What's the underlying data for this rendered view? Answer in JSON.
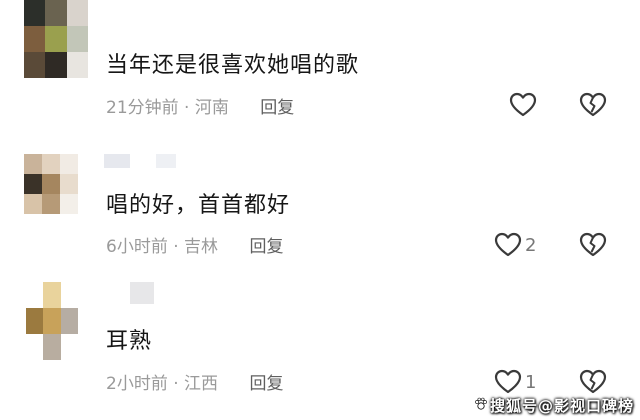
{
  "comments": [
    {
      "text": "当年还是很喜欢她唱的歌",
      "time": "21分钟前",
      "separator": "·",
      "location": "河南",
      "reply_label": "回复",
      "like_count": "",
      "avatar_colors": [
        "#2c2f2a",
        "#6a6350",
        "#d9d3cc",
        "#7d5e3e",
        "#9aa04e",
        "#c2c6b8",
        "#5a4a38",
        "#2f2a25",
        "#e8e5e0"
      ]
    },
    {
      "text": "唱的好，首首都好",
      "time": "6小时前",
      "separator": "·",
      "location": "吉林",
      "reply_label": "回复",
      "like_count": "2",
      "avatar_colors": [
        "#c9b39a",
        "#e2d2bf",
        "#f1ebe4",
        "#3a3228",
        "#a5865f",
        "#e8dccd",
        "#d8c3a8",
        "#b69a77",
        "#f3efe9"
      ]
    },
    {
      "text": "耳熟",
      "time": "2小时前",
      "separator": "·",
      "location": "江西",
      "reply_label": "回复",
      "like_count": "1",
      "avatar_colors": [
        "#ffffff",
        "#e9d39c",
        "#ffffff",
        "#9b7a3f",
        "#c8a25a",
        "#b6ada3",
        "#ffffff",
        "#b8ada0",
        "#ffffff"
      ]
    }
  ],
  "watermark": {
    "text": "搜狐号@影视口碑榜"
  },
  "icons": {
    "like": "heart-outline-icon",
    "dislike": "broken-heart-icon"
  }
}
